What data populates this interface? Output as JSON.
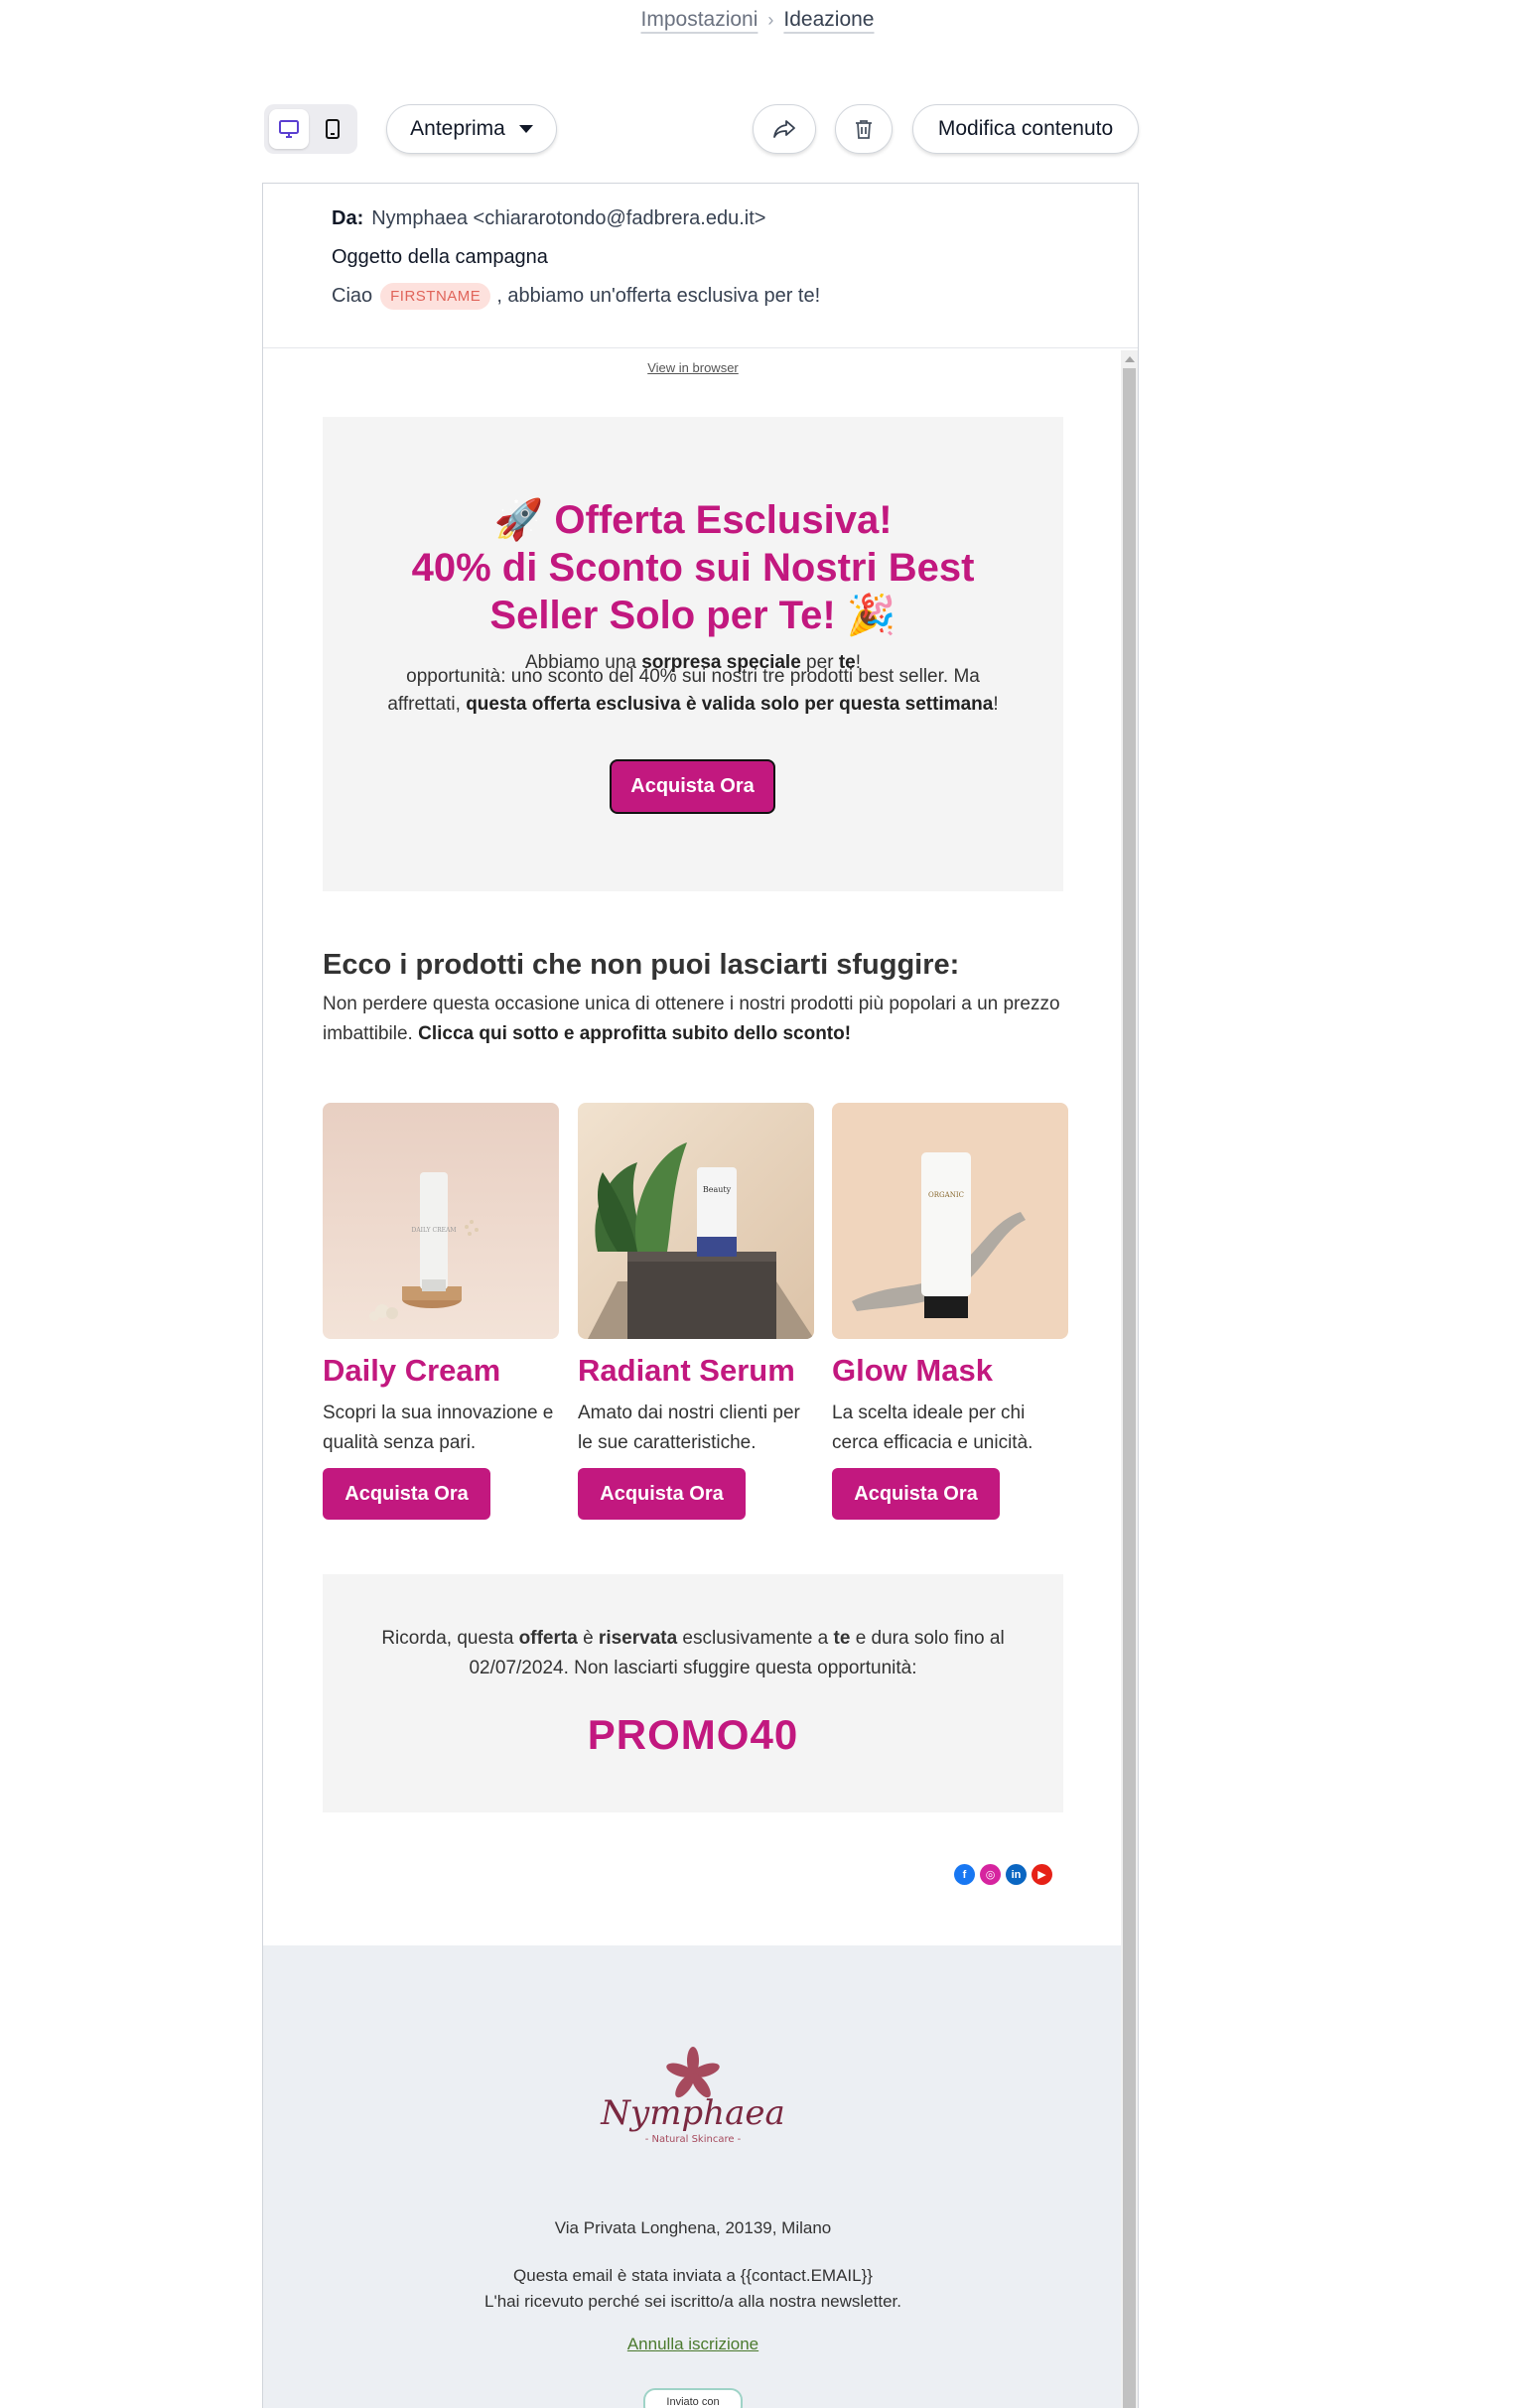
{
  "breadcrumb": {
    "item1": "Impostazioni",
    "item2": "Ideazione"
  },
  "toolbar": {
    "preview_label": "Anteprima",
    "edit_label": "Modifica contenuto"
  },
  "meta": {
    "from_label": "Da:",
    "from_value": "Nymphaea <chiararotondo@fadbrera.edu.it>",
    "subject": "Oggetto della campagna",
    "preview_before": "Ciao",
    "preview_chip": "FIRSTNAME",
    "preview_after": ", abbiamo un'offerta esclusiva per te!"
  },
  "email": {
    "view_in_browser": "View in browser",
    "hero": {
      "title_line1": "🚀 Offerta Esclusiva!",
      "title_line2": "40% di Sconto sui Nostri Best",
      "title_line3": "Seller Solo per Te! 🎉",
      "sub_line1_a": "Abbiamo una ",
      "sub_line1_b": "sorpresa speciale",
      "sub_line1_c": " per ",
      "sub_line1_d": "te",
      "sub_line1_e": "!",
      "sub_line2": "opportunità: uno sconto del 40% sui nostri tre prodotti best seller. Ma",
      "sub_line3_a": "affrettati, ",
      "sub_line3_b": "questa offerta esclusiva è valida solo per questa settimana",
      "sub_line3_c": "!",
      "button": "Acquista Ora"
    },
    "section": {
      "title": "Ecco i prodotti che non puoi lasciarti sfuggire:",
      "text_a": "Non perdere questa occasione unica di ottenere i nostri prodotti più popolari a un prezzo imbattibile. ",
      "text_b": "Clicca qui sotto e approfitta subito dello sconto!"
    },
    "products": [
      {
        "name": "Daily Cream",
        "desc": "Scopri la sua innovazione e qualità senza pari.",
        "button": "Acquista Ora",
        "tube_label": "DAILY CREAM"
      },
      {
        "name": "Radiant Serum",
        "desc": "Amato dai nostri clienti per le sue caratteristiche.",
        "button": "Acquista Ora",
        "tube_label": "Beauty"
      },
      {
        "name": "Glow Mask",
        "desc": "La scelta ideale per chi cerca efficacia e unicità.",
        "button": "Acquista Ora",
        "tube_label": "ORGANIC"
      }
    ],
    "promo": {
      "t1": "Ricorda, questa ",
      "t2": "offerta",
      "t3": " è ",
      "t4": "riservata",
      "t5": " esclusivamente a ",
      "t6": "te",
      "t7": " e dura solo fino al 02/07/2024. Non lasciarti sfuggire questa opportunità:",
      "code": "PROMO40"
    },
    "footer": {
      "logo_text": "Nymphaea",
      "logo_tagline": "- Natural Skincare -",
      "address": "Via Privata Longhena, 20139, Milano",
      "sent_line1": "Questa email è stata inviata a {{contact.EMAIL}}",
      "sent_line2": "L'hai ricevuto perché sei iscritto/a alla nostra newsletter.",
      "unsubscribe": "Annulla iscrizione",
      "sent_with": "Inviato con"
    }
  },
  "colors": {
    "brand": "#c2187f",
    "footer_bg": "#eceff3",
    "hero_bg": "#f4f4f4"
  }
}
